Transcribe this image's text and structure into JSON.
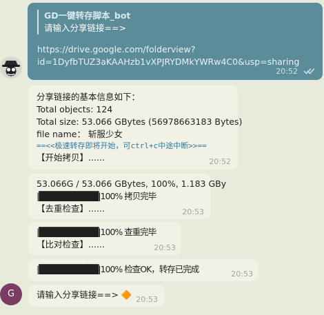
{
  "outgoing_message": {
    "reply_sender": "GD一键转存脚本_bot",
    "reply_text": "请输入分享链接==>",
    "link_line1": "https://drive.google.com/folderview?",
    "link_line2": "id=1DyfbTUZ3aKAAHzb1vXPJRYDMkYWRw4C0&usp=sharing",
    "time": "20:52",
    "status": "read-double-check-icon"
  },
  "messages": [
    {
      "lines": [
        "分享链接的基本信息如下：",
        "Total objects: 124",
        "Total size: 53.066 GBytes (56978663183 Bytes)",
        "file name：  斩服少女"
      ],
      "mono_line": "==<<极速转存即将开始，可ctrl+c中途中断>>==",
      "tail_line": "【开始拷贝】......",
      "time": "20:52"
    },
    {
      "lines": [
        "53.066G / 53.066 GBytes, 100%, 1.183 GBy",
        "|██████████|100%  拷贝完毕",
        "【去重检查】......"
      ],
      "time": "20:53"
    },
    {
      "lines": [
        "|██████████|100%  查重完毕",
        "【比对检查】......"
      ],
      "time": "20:53"
    },
    {
      "lines": [
        "|██████████|100%  检查OK，转存已完成"
      ],
      "time": "20:53"
    },
    {
      "lines": [
        "请输入分享链接==> 🔶"
      ],
      "time": "20:53"
    }
  ],
  "avatars": {
    "user_icon": "hacker-hat-avatar-icon",
    "bot_initial": "G",
    "bot_color": "#7a3c62"
  },
  "colors": {
    "background": "#e6ebdb",
    "outgoing_bubble": "#5c8c9a",
    "incoming_bubble": "#f1f1e6",
    "mono_text": "#2f79a3"
  }
}
